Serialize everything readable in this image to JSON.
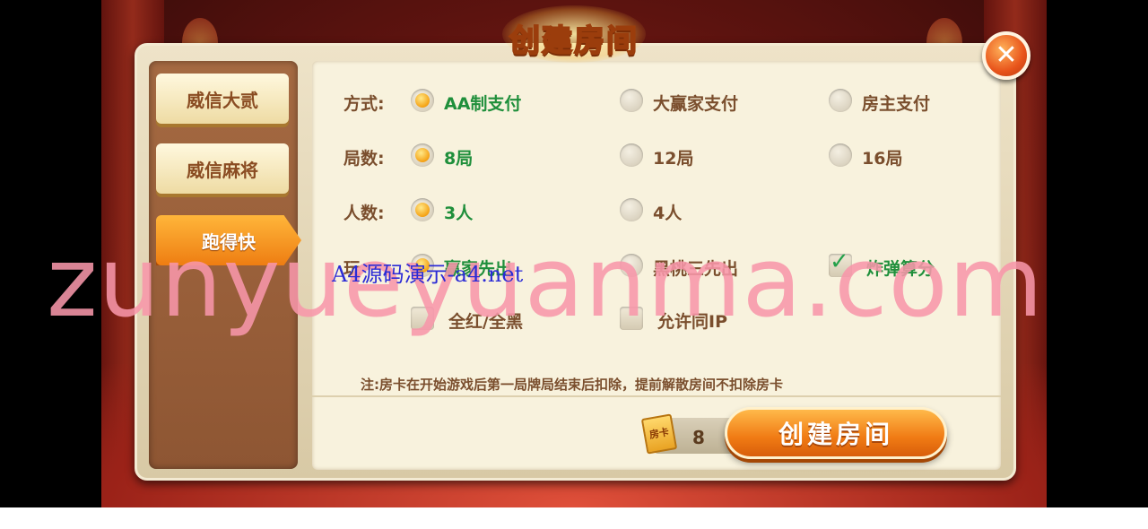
{
  "title": "创建房间",
  "close_icon": "close-icon",
  "tabs": [
    {
      "label": "威信大贰",
      "active": false
    },
    {
      "label": "威信麻将",
      "active": false
    },
    {
      "label": "跑得快",
      "active": true
    }
  ],
  "rows": {
    "payment": {
      "label": "方式:",
      "options": [
        "AA制支付",
        "大赢家支付",
        "房主支付"
      ],
      "selected": 0
    },
    "rounds": {
      "label": "局数:",
      "options": [
        "8局",
        "12局",
        "16局"
      ],
      "selected": 0
    },
    "players": {
      "label": "人数:",
      "options": [
        "3人",
        "4人"
      ],
      "selected": 0
    },
    "play": {
      "label": "玩",
      "options": [
        "赢家先出",
        "黑桃三先出"
      ],
      "checkbox": "炸弹算分",
      "checkbox_checked": true
    },
    "extra": {
      "checkboxes": [
        "全红/全黑",
        "允许同IP"
      ]
    }
  },
  "note": "注:房卡在开始游戏后第一局牌局结束后扣除，提前解散房间不扣除房卡",
  "room_card": {
    "icon_text": "房卡",
    "count": "8"
  },
  "create_button": "创建房间",
  "watermark": {
    "main": "zunyueyuanma.com",
    "secondary": "A4源码演示-a4.net"
  },
  "colors": {
    "selected_text": "#1f8f3b",
    "label_text": "#7a4e2d",
    "accent": "#f07b14"
  }
}
